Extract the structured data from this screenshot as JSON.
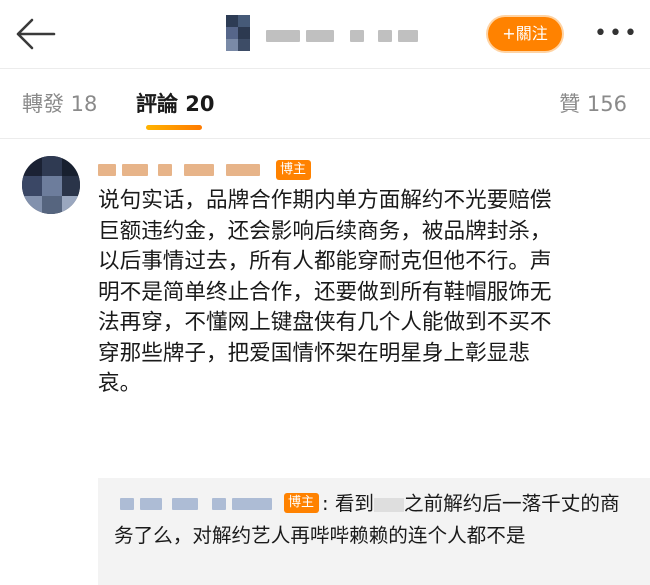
{
  "header": {
    "back_icon": "back-arrow-icon",
    "follow_label": "+關注",
    "more_label": "•••"
  },
  "tabs": {
    "repost": "轉發 18",
    "comments": "評論 20",
    "likes": "贊 156"
  },
  "comment": {
    "badge": "博主",
    "text": "说句实话，品牌合作期内单方面解约不光要赔偿\n巨额违约金，还会影响后续商务，被品牌封杀，\n以后事情过去，所有人都能穿耐克但他不行。声\n明不是简单终止合作，还要做到所有鞋帽服饰无\n法再穿，不懂网上键盘侠有几个人能做到不买不\n穿那些牌子，把爱国情怀架在明星身上彰显悲\n哀。"
  },
  "reply": {
    "badge": "博主",
    "text_before": ": 看到",
    "text_after": "之前解约后一落千丈的商务了么，对解约艺人再哔哔赖赖的连个人都不是"
  },
  "colors": {
    "accent": "#ff8200",
    "tab_underline_start": "#ffb400",
    "tab_underline_end": "#ff7a00",
    "reply_bg": "#f3f3f3"
  }
}
